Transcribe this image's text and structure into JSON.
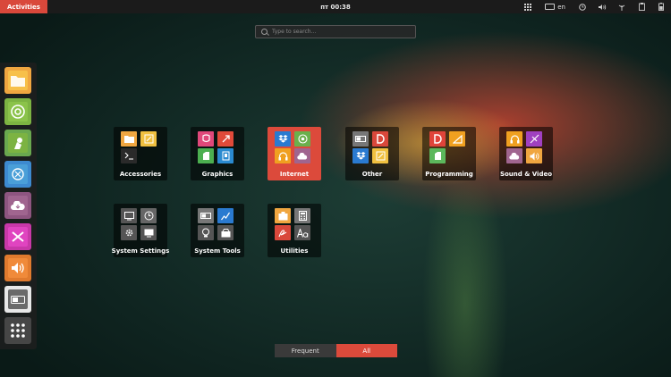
{
  "topbar": {
    "activities_label": "Activities",
    "clock": "пт 00:38",
    "lang": "en",
    "tray_icons": [
      "grid-menu-icon",
      "keyboard-icon",
      "clock-icon",
      "volume-icon",
      "network-icon",
      "clipboard-icon",
      "battery-icon"
    ]
  },
  "search": {
    "placeholder": "Type to search..."
  },
  "dock": {
    "items": [
      {
        "name": "files",
        "icon": "folder-icon",
        "color": "#f0a640"
      },
      {
        "name": "chrome",
        "icon": "chrome-icon",
        "color": "#7cb342"
      },
      {
        "name": "shotwell",
        "icon": "photo-icon",
        "color": "#8bc34a"
      },
      {
        "name": "network-manager",
        "icon": "network-icon",
        "color": "#4a9fd8"
      },
      {
        "name": "cloud",
        "icon": "cloud-icon",
        "color": "#a0658f"
      },
      {
        "name": "crossover",
        "icon": "shuffle-icon",
        "color": "#e044c0"
      },
      {
        "name": "sound",
        "icon": "speaker-icon",
        "color": "#f08a3a"
      },
      {
        "name": "toggle",
        "icon": "toggle-icon",
        "color": "#6a6a6a"
      },
      {
        "name": "show-apps",
        "icon": "app-grid-icon",
        "color": "#464646"
      }
    ]
  },
  "folders": [
    {
      "label": "Accessories",
      "active": false,
      "icons": [
        "#f0a640",
        "#f0c040",
        "#333333",
        ""
      ]
    },
    {
      "label": "Graphics",
      "active": false,
      "icons": [
        "#e0487a",
        "#e04a3a",
        "#4caf50",
        "#2a8ad0"
      ]
    },
    {
      "label": "Internet",
      "active": true,
      "icons": [
        "#2a7ad0",
        "#6ab04c",
        "#f0a020",
        "#a0658f"
      ]
    },
    {
      "label": "Other",
      "active": false,
      "icons": [
        "#777777",
        "#d9483b",
        "#2a7ad0",
        "#f0c040"
      ]
    },
    {
      "label": "Programming",
      "active": false,
      "icons": [
        "#e0443a",
        "#f0a020",
        "#5cb85c",
        ""
      ]
    },
    {
      "label": "Sound & Video",
      "active": false,
      "icons": [
        "#f0a020",
        "#a040c0",
        "#a0658f",
        "#f0a640"
      ]
    },
    {
      "label": "System Settings",
      "active": false,
      "icons": [
        "#555555",
        "#666666",
        "#555555",
        "#555555"
      ]
    },
    {
      "label": "System Tools",
      "active": false,
      "icons": [
        "#777777",
        "#2a7ad0",
        "#555555",
        "#555555"
      ]
    },
    {
      "label": "Utilities",
      "active": false,
      "icons": [
        "#f0a640",
        "#777777",
        "#d9483b",
        "#555555"
      ]
    }
  ],
  "switch": {
    "frequent_label": "Frequent",
    "all_label": "All"
  }
}
